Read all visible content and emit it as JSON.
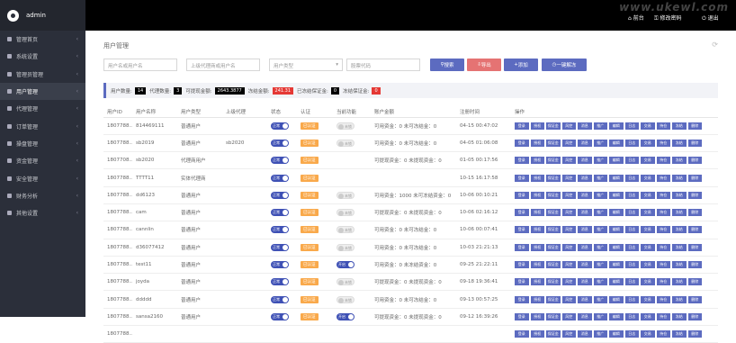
{
  "sidebar": {
    "user": "admin",
    "items": [
      {
        "label": "管理首页",
        "active": false
      },
      {
        "label": "系统设置",
        "active": false
      },
      {
        "label": "管理员管理",
        "active": false
      },
      {
        "label": "用户管理",
        "active": true
      },
      {
        "label": "代理管理",
        "active": false
      },
      {
        "label": "订单管理",
        "active": false
      },
      {
        "label": "操盘管理",
        "active": false
      },
      {
        "label": "资金管理",
        "active": false
      },
      {
        "label": "安全管理",
        "active": false
      },
      {
        "label": "财务分析",
        "active": false
      },
      {
        "label": "其他设置",
        "active": false
      }
    ]
  },
  "topbar": {
    "watermark": "www.ukewl.com",
    "front": "前台",
    "pwd": "修改密码",
    "logout": "退出"
  },
  "main": {
    "title": "用户管理",
    "search": {
      "user_ph": "用户名或用户名",
      "agent_ph": "上级代理商或用户名",
      "type_ph": "用户类型",
      "stock_ph": "股票代码",
      "btn_search": "搜索",
      "btn_export": "导出",
      "btn_add": "添加",
      "btn_unlock": "一键解冻"
    },
    "stats": [
      {
        "label": "用户数量:",
        "value": "14",
        "color": "#000"
      },
      {
        "label": "代理数量:",
        "value": "3",
        "color": "#000"
      },
      {
        "label": "可提现金额:",
        "value": "2643.3877",
        "color": "#000"
      },
      {
        "label": "冻结金额:",
        "value": "241.31",
        "color": "#e53935"
      },
      {
        "label": "已冻结保证金:",
        "value": "0",
        "color": "#000"
      },
      {
        "label": "冻结保证金:",
        "value": "0",
        "color": "#e53935"
      }
    ],
    "columns": [
      "用户ID",
      "用户名称",
      "用户类型",
      "上级代理",
      "状态",
      "认证",
      "当前功能",
      "账户金额",
      "注册时间",
      "操作"
    ],
    "rows": [
      {
        "id": "1807788...",
        "name": "814469111",
        "type": "普通用户",
        "agent": "",
        "status": "正常",
        "status_on": true,
        "auth": "已认证",
        "func": "未锁",
        "func_on": false,
        "balance": "可用资金：0 未可冻结金：0",
        "time": "04-15 00:47:02"
      },
      {
        "id": "1807788...",
        "name": "sb2019",
        "type": "普通用户",
        "agent": "sb2020",
        "status": "正常",
        "status_on": true,
        "auth": "已认证",
        "func": "未锁",
        "func_on": false,
        "balance": "可用资金：0 未可冻结金：0",
        "time": "04-05 01:06:08"
      },
      {
        "id": "1807708...",
        "name": "sb2020",
        "type": "代理商用户",
        "agent": "",
        "status": "正常",
        "status_on": true,
        "auth": "已认证",
        "func": "",
        "func_on": false,
        "balance": "可提现资金：0 未提现资金：0",
        "time": "01-05 00:17:56"
      },
      {
        "id": "1807788...",
        "name": "TTTT11",
        "type": "实体代理商",
        "agent": "",
        "status": "正常",
        "status_on": true,
        "auth": "已认证",
        "func": "",
        "func_on": false,
        "balance": "",
        "time": "10-15 16:17:58"
      },
      {
        "id": "1807788...",
        "name": "dd6123",
        "type": "普通用户",
        "agent": "",
        "status": "正常",
        "status_on": true,
        "auth": "已认证",
        "func": "未锁",
        "func_on": false,
        "balance": "可用资金：1000 未可冻结资金：0",
        "time": "10-06 00:10:21"
      },
      {
        "id": "1807788...",
        "name": "cam",
        "type": "普通用户",
        "agent": "",
        "status": "正常",
        "status_on": true,
        "auth": "已认证",
        "func": "未锁",
        "func_on": false,
        "balance": "可提现资金：0 未提现资金：0",
        "time": "10-06 02:16:12"
      },
      {
        "id": "1807788...",
        "name": "cannlin",
        "type": "普通用户",
        "agent": "",
        "status": "正常",
        "status_on": true,
        "auth": "已认证",
        "func": "未锁",
        "func_on": false,
        "balance": "可用资金：0 未可冻结金：0",
        "time": "10-06 00:07:41"
      },
      {
        "id": "1807788...",
        "name": "d36077412",
        "type": "普通用户",
        "agent": "",
        "status": "正常",
        "status_on": true,
        "auth": "已认证",
        "func": "未锁",
        "func_on": false,
        "balance": "可用资金：0 未可冻结金：0",
        "time": "10-03 21:21:13"
      },
      {
        "id": "1807788...",
        "name": "test11",
        "type": "普通用户",
        "agent": "",
        "status": "正常",
        "status_on": true,
        "auth": "已认证",
        "func": "开启",
        "func_on": true,
        "balance": "可用资金：0 未冻结资金：0",
        "time": "09-25 21:22:11"
      },
      {
        "id": "1807788...",
        "name": "joyda",
        "type": "普通用户",
        "agent": "",
        "status": "正常",
        "status_on": true,
        "auth": "已认证",
        "func": "未锁",
        "func_on": false,
        "balance": "可提现资金：0 未提现资金：0",
        "time": "09-18 19:36:41"
      },
      {
        "id": "1807788...",
        "name": "ddddd",
        "type": "普通用户",
        "agent": "",
        "status": "正常",
        "status_on": true,
        "auth": "已认证",
        "func": "未锁",
        "func_on": false,
        "balance": "可用资金：0 未可冻结金：0",
        "time": "09-13 00:57:25"
      },
      {
        "id": "1807788...",
        "name": "sansa2160",
        "type": "普通用户",
        "agent": "",
        "status": "正常",
        "status_on": true,
        "auth": "已认证",
        "func": "开启",
        "func_on": true,
        "balance": "可提现资金：0 未提现资金：0",
        "time": "09-12 16:39:26"
      },
      {
        "id": "1807788...",
        "name": "",
        "type": "",
        "agent": "",
        "status": "",
        "status_on": true,
        "auth": "",
        "func": "",
        "func_on": false,
        "balance": "",
        "time": ""
      }
    ],
    "ops": [
      "登录",
      "授权",
      "保证金",
      "风控",
      "消息",
      "推广",
      "编辑",
      "日志",
      "交易",
      "持仓",
      "冻结",
      "删除"
    ]
  },
  "colors": {
    "primary": "#5c6bc0",
    "danger": "#e57373",
    "warning": "#f9a94b",
    "sidebar": "#2b2f3a"
  }
}
